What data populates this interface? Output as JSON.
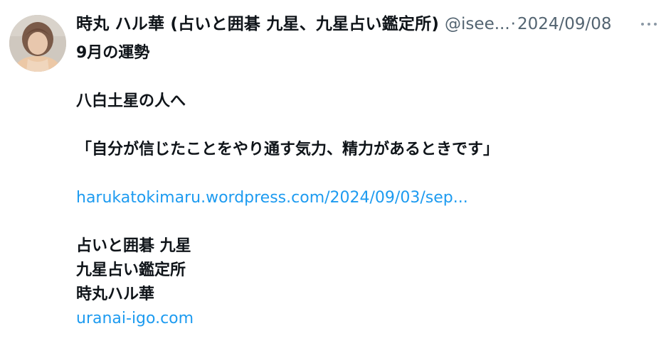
{
  "post": {
    "author": {
      "display_name": "時丸 ハル華 (占いと囲碁 九星、九星占い鑑定所)",
      "handle": "@isee...",
      "separator": "·",
      "date": "2024/09/08"
    },
    "lines": {
      "l1": "9月の運勢",
      "l3": "八白土星の人へ",
      "l5": "「自分が信じたことをやり通す気力、精力があるときです」",
      "l7": "harukatokimaru.wordpress.com/2024/09/03/sep...",
      "l9": "占いと囲碁 九星",
      "l10": "九星占い鑑定所",
      "l11": "時丸ハル華",
      "l12": "uranai-igo.com"
    },
    "icons": {
      "more": "more-horizontal-icon",
      "avatar": "profile-photo"
    },
    "colors": {
      "text": "#0f1419",
      "secondary": "#536471",
      "link": "#1d9bf0"
    }
  }
}
